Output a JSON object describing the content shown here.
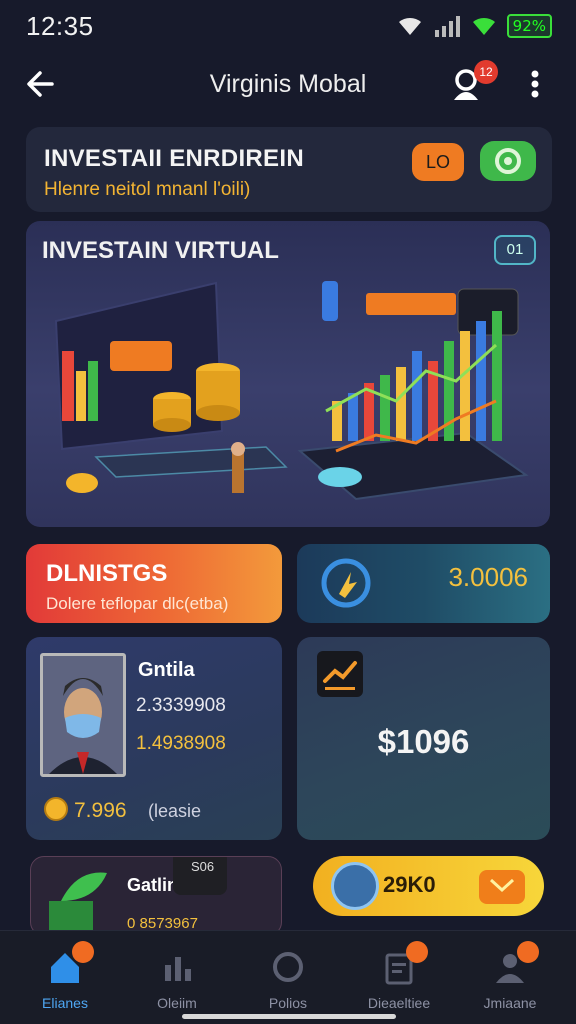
{
  "status": {
    "time": "12:35",
    "battery": "92%"
  },
  "app": {
    "title": "Virginis Mobal",
    "notifications": "12"
  },
  "hero": {
    "title": "INVESTAII ENRDIREIN",
    "subtitle": "Hlenre neitol mnanl l'oili)",
    "pill": "LO"
  },
  "banner": {
    "title": "INVESTAIN VIRTUAL",
    "badge": "01"
  },
  "promo": {
    "title": "DLNISTGS",
    "subtitle": "Dolere teflopar dlc(etba)"
  },
  "value": {
    "amount": "3.0006"
  },
  "profile": {
    "name": "Gntila",
    "line1": "2.3339908",
    "line2": "1.4938908",
    "value": "7.996",
    "note": "(leasie"
  },
  "balance": {
    "amount": "$1096"
  },
  "mini": {
    "title": "Gatlin",
    "value": "0 8573967",
    "tag": "S06"
  },
  "gift": {
    "value": "29K0"
  },
  "nav": {
    "items": [
      {
        "label": "Elianes",
        "icon": "home-icon",
        "active": true
      },
      {
        "label": "Oleiim",
        "icon": "chart-icon",
        "active": false
      },
      {
        "label": "Polios",
        "icon": "circle-icon",
        "active": false
      },
      {
        "label": "Dieaeltiee",
        "icon": "document-icon",
        "active": false
      },
      {
        "label": "Jmiaane",
        "icon": "profile-icon",
        "active": false
      }
    ]
  },
  "colors": {
    "accent_gold": "#f3c03e",
    "accent_orange": "#ef7b22",
    "bg": "#171a2b"
  }
}
